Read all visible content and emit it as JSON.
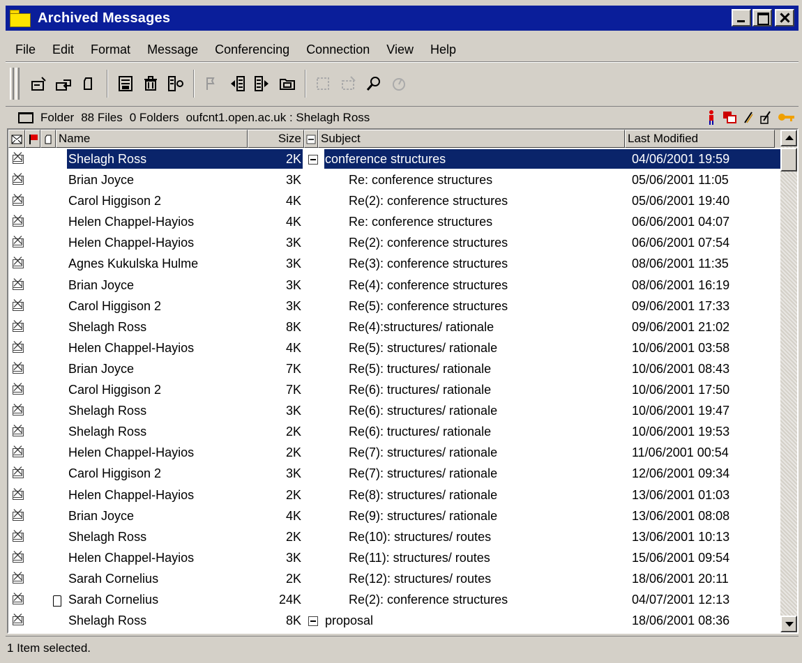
{
  "window": {
    "title": "Archived Messages"
  },
  "menu": [
    "File",
    "Edit",
    "Format",
    "Message",
    "Conferencing",
    "Connection",
    "View",
    "Help"
  ],
  "toolbar": {
    "buttons": [
      "new-message-icon",
      "reply-icon",
      "new-document-icon",
      "save-icon",
      "delete-icon",
      "move-icon",
      "flag-icon",
      "previous-icon",
      "next-icon",
      "folder-icon",
      "disabled-tool-icon",
      "disabled-tool2-icon",
      "search-icon",
      "disabled-tool3-icon"
    ]
  },
  "infobar": {
    "label": "Folder",
    "files": "88 Files",
    "folders": "0 Folders",
    "location": "oufcnt1.open.ac.uk : Shelagh Ross"
  },
  "columns": {
    "name": "Name",
    "size": "Size",
    "subject": "Subject",
    "modified": "Last Modified"
  },
  "rows": [
    {
      "name": "Shelagh Ross",
      "size": "2K",
      "subject": "conference structures",
      "date": "04/06/2001  19:59"
    },
    {
      "name": "Brian Joyce",
      "size": "3K",
      "subject": "Re: conference structures",
      "date": "05/06/2001  11:05"
    },
    {
      "name": "Carol Higgison 2",
      "size": "4K",
      "subject": "Re(2): conference structures",
      "date": "05/06/2001  19:40"
    },
    {
      "name": "Helen Chappel-Hayios",
      "size": "4K",
      "subject": "Re: conference structures",
      "date": "06/06/2001  04:07"
    },
    {
      "name": "Helen Chappel-Hayios",
      "size": "3K",
      "subject": "Re(2): conference structures",
      "date": "06/06/2001  07:54"
    },
    {
      "name": "Agnes Kukulska Hulme",
      "size": "3K",
      "subject": "Re(3): conference structures",
      "date": "08/06/2001  11:35"
    },
    {
      "name": "Brian Joyce",
      "size": "3K",
      "subject": "Re(4): conference structures",
      "date": "08/06/2001  16:19"
    },
    {
      "name": "Carol Higgison 2",
      "size": "3K",
      "subject": "Re(5): conference structures",
      "date": "09/06/2001  17:33"
    },
    {
      "name": "Shelagh Ross",
      "size": "8K",
      "subject": "Re(4):structures/ rationale",
      "date": "09/06/2001  21:02"
    },
    {
      "name": "Helen Chappel-Hayios",
      "size": "4K",
      "subject": "Re(5): structures/ rationale",
      "date": "10/06/2001  03:58"
    },
    {
      "name": "Brian Joyce",
      "size": "7K",
      "subject": "Re(5): tructures/ rationale",
      "date": "10/06/2001  08:43"
    },
    {
      "name": "Carol Higgison 2",
      "size": "7K",
      "subject": "Re(6): tructures/ rationale",
      "date": "10/06/2001  17:50"
    },
    {
      "name": "Shelagh Ross",
      "size": "3K",
      "subject": "Re(6): structures/ rationale",
      "date": "10/06/2001  19:47"
    },
    {
      "name": "Shelagh Ross",
      "size": "2K",
      "subject": "Re(6): tructures/ rationale",
      "date": "10/06/2001  19:53"
    },
    {
      "name": "Helen Chappel-Hayios",
      "size": "2K",
      "subject": "Re(7): structures/ rationale",
      "date": "11/06/2001  00:54"
    },
    {
      "name": "Carol Higgison 2",
      "size": "3K",
      "subject": "Re(7): structures/ rationale",
      "date": "12/06/2001  09:34"
    },
    {
      "name": "Helen Chappel-Hayios",
      "size": "2K",
      "subject": "Re(8): structures/ rationale",
      "date": "13/06/2001  01:03"
    },
    {
      "name": "Brian Joyce",
      "size": "4K",
      "subject": "Re(9): structures/ rationale",
      "date": "13/06/2001  08:08"
    },
    {
      "name": "Shelagh Ross",
      "size": "2K",
      "subject": "Re(10): structures/ routes",
      "date": "13/06/2001  10:13"
    },
    {
      "name": "Helen Chappel-Hayios",
      "size": "3K",
      "subject": "Re(11): structures/ routes",
      "date": "15/06/2001  09:54"
    },
    {
      "name": "Sarah Cornelius",
      "size": "2K",
      "subject": "Re(12): structures/ routes",
      "date": "18/06/2001  20:11"
    },
    {
      "name": "Sarah Cornelius",
      "size": "24K",
      "subject": "Re(2): conference structures",
      "date": "04/07/2001  12:13"
    },
    {
      "name": "Shelagh Ross",
      "size": "8K",
      "subject": "proposal",
      "date": "18/06/2001  08:36"
    }
  ],
  "status": {
    "text": "1 Item selected."
  }
}
